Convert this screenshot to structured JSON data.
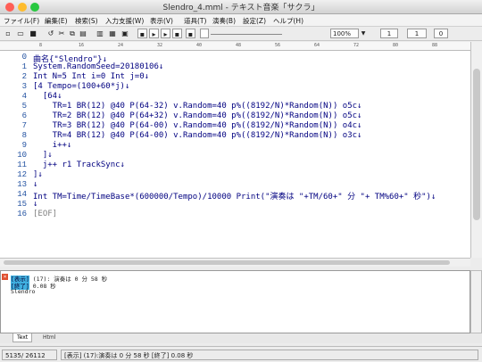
{
  "window": {
    "title": "Slendro_4.mml - テキスト音楽「サクラ」"
  },
  "menu": [
    "ファイル(F)",
    "編集(E)",
    "検索(S)",
    "入力支援(W)",
    "表示(V)",
    "道具(T)",
    "演奏(B)",
    "設定(Z)",
    "ヘルプ(H)"
  ],
  "toolbar": {
    "zoom": "100%",
    "spin1": "1",
    "spin2": "1",
    "spin3": "0"
  },
  "ruler": [
    "8",
    "16",
    "24",
    "32",
    "40",
    "48",
    "56",
    "64",
    "72",
    "80",
    "88"
  ],
  "editor": {
    "line_numbers": [
      "0",
      "1",
      "2",
      "3",
      "4",
      "5",
      "6",
      "7",
      "8",
      "9",
      "10",
      "11",
      "12",
      "13",
      "14",
      "15",
      "16"
    ],
    "lines": [
      "曲名{\"Slendro\"}↓",
      "System.RandomSeed=20180106↓",
      "Int N=5 Int i=0 Int j=0↓",
      "[4 Tempo=(100+60*j)↓",
      "  [64↓",
      "    TR=1 BR(12) @40 P(64-32) v.Random=40 p%((8192/N)*Random(N)) o5c↓",
      "    TR=2 BR(12) @40 P(64+32) v.Random=40 p%((8192/N)*Random(N)) o5c↓",
      "    TR=3 BR(12) @40 P(64-00) v.Random=40 p%((8192/N)*Random(N)) o4c↓",
      "    TR=4 BR(12) @40 P(64-00) v.Random=40 p%((8192/N)*Random(N)) o3c↓",
      "    i++↓",
      "  ]↓",
      "  j++ r1 TrackSync↓",
      "]↓",
      "↓",
      "Int TM=Time/TimeBase*(600000/Tempo)/10000 Print(\"演奏は \"+TM/60+\" 分 \"+ TM%60+\" 秒\")↓",
      "↓",
      "[EOF]"
    ]
  },
  "output": {
    "line1_tag": "[表示]",
    "line1_text": " (17): 演奏は 0 分 58 秒",
    "line2_tag": "[終了]",
    "line2_text": " 0.08 秒",
    "line3_text": "Slendro"
  },
  "tabs": {
    "text": "Text",
    "html": "Html"
  },
  "status": {
    "position": "5135/ 26112",
    "message": "[表示] (17):演奏は 0 分 58 秒 [終了] 0.08 秒"
  },
  "colors": {
    "code": "#000080",
    "numbers": "#2050a0",
    "eof": "#808080",
    "tag_bg": "#40b0e0",
    "close": "#ff5f57",
    "minimize": "#febc2e",
    "maximize": "#28c840"
  }
}
